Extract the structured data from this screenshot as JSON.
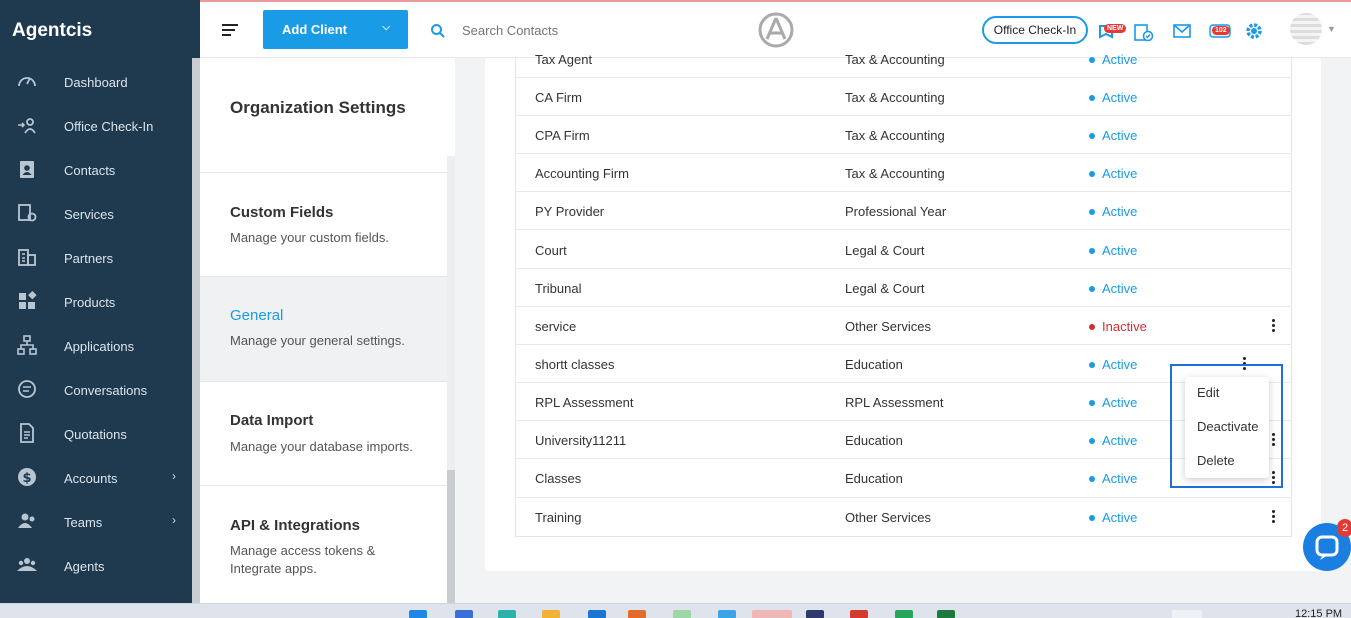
{
  "app": {
    "brand": "Agentcis"
  },
  "topbar": {
    "add_client_label": "Add Client",
    "search_placeholder": "Search Contacts",
    "checkin_label": "Office Check-In",
    "new_badge": "NEW",
    "notification_count": "102"
  },
  "sidebar": {
    "items": [
      {
        "label": "Dashboard",
        "icon": "gauge-icon"
      },
      {
        "label": "Office Check-In",
        "icon": "checkin-icon"
      },
      {
        "label": "Contacts",
        "icon": "contact-card-icon"
      },
      {
        "label": "Services",
        "icon": "services-icon"
      },
      {
        "label": "Partners",
        "icon": "building-icon"
      },
      {
        "label": "Products",
        "icon": "products-icon"
      },
      {
        "label": "Applications",
        "icon": "flow-icon"
      },
      {
        "label": "Conversations",
        "icon": "chat-icon"
      },
      {
        "label": "Quotations",
        "icon": "document-icon"
      },
      {
        "label": "Accounts",
        "icon": "dollar-icon"
      },
      {
        "label": "Teams",
        "icon": "team-icon"
      },
      {
        "label": "Agents",
        "icon": "agents-icon"
      }
    ]
  },
  "settings": {
    "title": "Organization Settings",
    "items": [
      {
        "title": "Custom Fields",
        "desc": "Manage your custom fields."
      },
      {
        "title": "General",
        "desc": "Manage your general settings."
      },
      {
        "title": "Data Import",
        "desc": "Manage your database imports."
      },
      {
        "title": "API & Integrations",
        "desc": "Manage access tokens &",
        "desc2": "Integrate apps."
      }
    ]
  },
  "table": {
    "rows": [
      {
        "name": "Tax Agent",
        "category": "Tax & Accounting",
        "status": "Active"
      },
      {
        "name": "CA Firm",
        "category": "Tax & Accounting",
        "status": "Active"
      },
      {
        "name": "CPA Firm",
        "category": "Tax & Accounting",
        "status": "Active"
      },
      {
        "name": "Accounting Firm",
        "category": "Tax & Accounting",
        "status": "Active"
      },
      {
        "name": "PY Provider",
        "category": "Professional Year",
        "status": "Active"
      },
      {
        "name": "Court",
        "category": "Legal & Court",
        "status": "Active"
      },
      {
        "name": "Tribunal",
        "category": "Legal & Court",
        "status": "Active"
      },
      {
        "name": "service",
        "category": "Other Services",
        "status": "Inactive"
      },
      {
        "name": "shortt classes",
        "category": "Education",
        "status": "Active"
      },
      {
        "name": "RPL Assessment",
        "category": "RPL Assessment",
        "status": "Active"
      },
      {
        "name": "University11211",
        "category": "Education",
        "status": "Active"
      },
      {
        "name": "Classes",
        "category": "Education",
        "status": "Active"
      },
      {
        "name": "Training",
        "category": "Other Services",
        "status": "Active"
      }
    ]
  },
  "row_menu": {
    "edit": "Edit",
    "deactivate": "Deactivate",
    "delete": "Delete"
  },
  "chat": {
    "unread": "2"
  },
  "taskbar": {
    "clock": "12:15 PM"
  },
  "colors": {
    "sidebar": "#1f3a4f",
    "accent": "#1a9be6",
    "inactive": "#d32f2f"
  }
}
